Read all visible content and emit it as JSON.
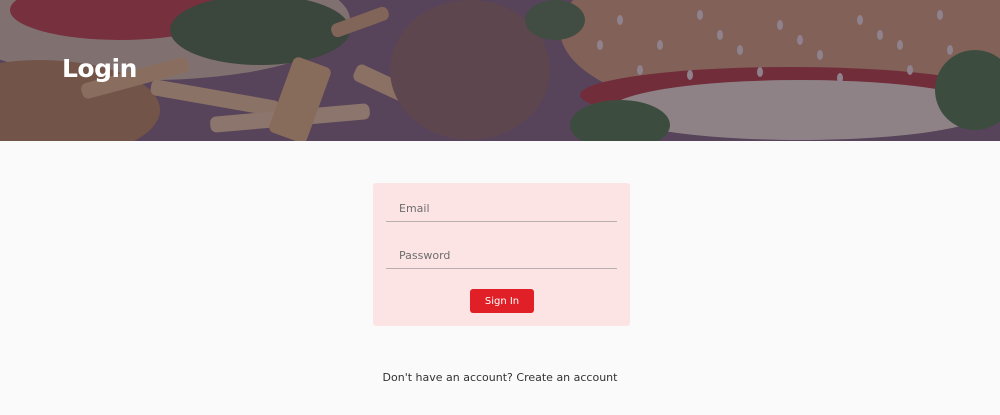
{
  "header": {
    "title": "Login",
    "background_image": "burger-and-fries-photo"
  },
  "login_form": {
    "email_placeholder": "Email",
    "email_value": "",
    "password_placeholder": "Password",
    "password_value": "",
    "submit_label": "Sign In"
  },
  "signup_prompt": {
    "text": "Don't have an account?",
    "link_label": "Create an account"
  },
  "colors": {
    "accent": "#e01f26",
    "card_background": "#fde4e4",
    "page_background": "#fafafa",
    "hero_overlay": "#3a2848"
  }
}
